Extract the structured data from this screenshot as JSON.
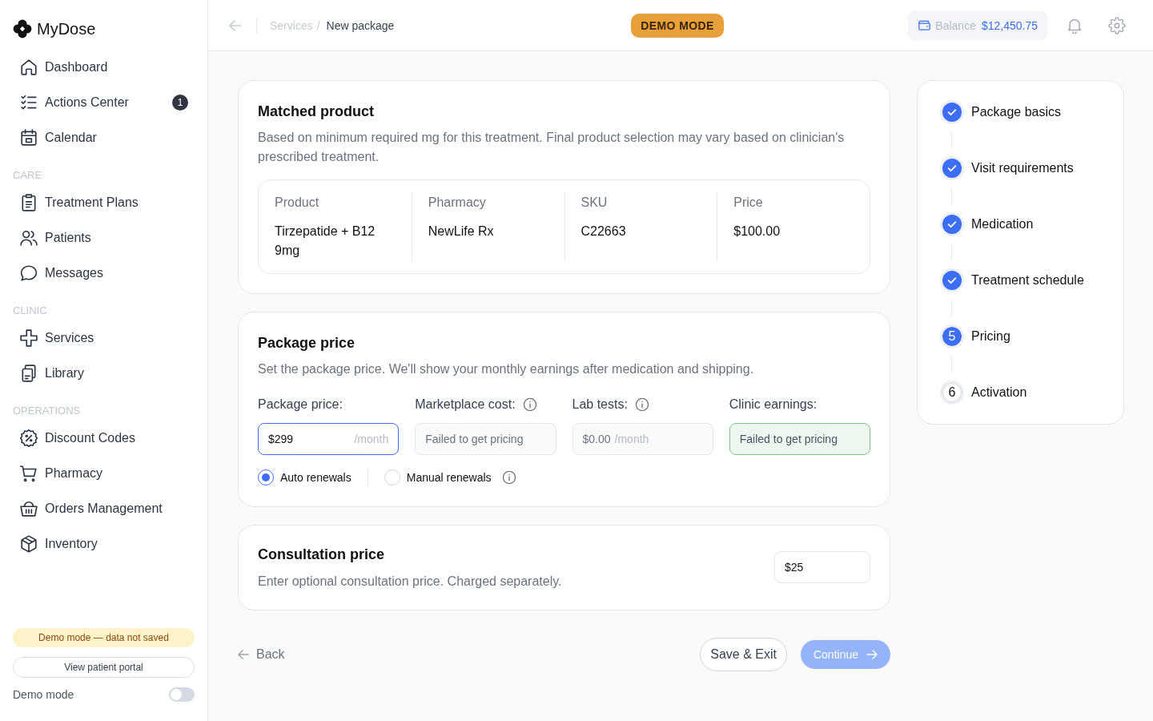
{
  "sidebar": {
    "logo": "MyDose",
    "sections": [
      {
        "items": [
          {
            "label": "Dashboard",
            "selected": false
          },
          {
            "label": "Actions Center",
            "badge": "1",
            "selected": false
          },
          {
            "label": "Calendar",
            "selected": false
          }
        ]
      },
      {
        "heading": "CARE",
        "items": [
          {
            "label": "Treatment Plans",
            "selected": false
          },
          {
            "label": "Patients",
            "selected": false
          },
          {
            "label": "Messages",
            "selected": false
          }
        ]
      },
      {
        "heading": "CLINIC",
        "items": [
          {
            "label": "Services",
            "selected": false
          },
          {
            "label": "Library",
            "selected": false
          }
        ]
      },
      {
        "heading": "OPERATIONS",
        "items": [
          {
            "label": "Discount Codes",
            "selected": false
          },
          {
            "label": "Pharmacy",
            "selected": false
          },
          {
            "label": "Orders Management",
            "selected": false
          },
          {
            "label": "Inventory",
            "selected": false
          }
        ]
      }
    ],
    "demo_notice": "Demo mode — data not saved",
    "portal_button": "View patient portal",
    "demo_toggle": {
      "label": "Demo mode",
      "on": false
    }
  },
  "top_bar": {
    "breadcrumb": {
      "items": [
        "Services",
        "New package"
      ],
      "separator": "/"
    },
    "mode_badge": "DEMO MODE",
    "balance": {
      "label": "Balance",
      "amount": "$12,450.75"
    }
  },
  "matched_product": {
    "title": "Matched product",
    "description": "Based on minimum required mg for this treatment. Final product selection may vary based on clinician's prescribed treatment.",
    "columns": [
      {
        "header": "Product",
        "value": "Tirzepatide + B12 9mg"
      },
      {
        "header": "Pharmacy",
        "value": "NewLife Rx"
      },
      {
        "header": "SKU",
        "value": "C22663"
      },
      {
        "header": "Price",
        "value": "$100.00"
      }
    ]
  },
  "package_price": {
    "title": "Package price",
    "description": "Set the package price. We'll show your monthly earnings after medication and shipping.",
    "fields": [
      {
        "label": "Package price:",
        "kind": "editable",
        "value": "$299",
        "suffix": "/month",
        "info": false,
        "focused": true
      },
      {
        "label": "Marketplace cost:",
        "kind": "readonly",
        "value": "Failed to get pricing",
        "info": true,
        "focused": false
      },
      {
        "label": "Lab tests:",
        "kind": "readonly",
        "value": "$0.00",
        "suffix": "/month",
        "info": true,
        "focused": false
      },
      {
        "label": "Clinic earnings:",
        "kind": "earnings",
        "value": "Failed to get pricing",
        "info": false,
        "focused": false
      }
    ],
    "renewals": [
      {
        "label": "Auto renewals",
        "selected": true,
        "info": false
      },
      {
        "label": "Manual renewals",
        "selected": false,
        "info": true
      }
    ]
  },
  "consultation_price": {
    "title": "Consultation price",
    "description": "Enter optional consultation price. Charged separately.",
    "value": "$25"
  },
  "footer": {
    "back": "Back",
    "save_exit": "Save & Exit",
    "continue": {
      "label": "Continue",
      "disabled": true
    }
  },
  "steps": [
    {
      "label": "Package basics",
      "completed": true,
      "selected": false
    },
    {
      "label": "Visit requirements",
      "completed": true,
      "selected": false
    },
    {
      "label": "Medication",
      "completed": true,
      "selected": false
    },
    {
      "label": "Treatment schedule",
      "completed": true,
      "selected": false
    },
    {
      "label": "Pricing",
      "number": "5",
      "completed": false,
      "selected": true
    },
    {
      "label": "Activation",
      "number": "6",
      "completed": false,
      "selected": false
    }
  ]
}
